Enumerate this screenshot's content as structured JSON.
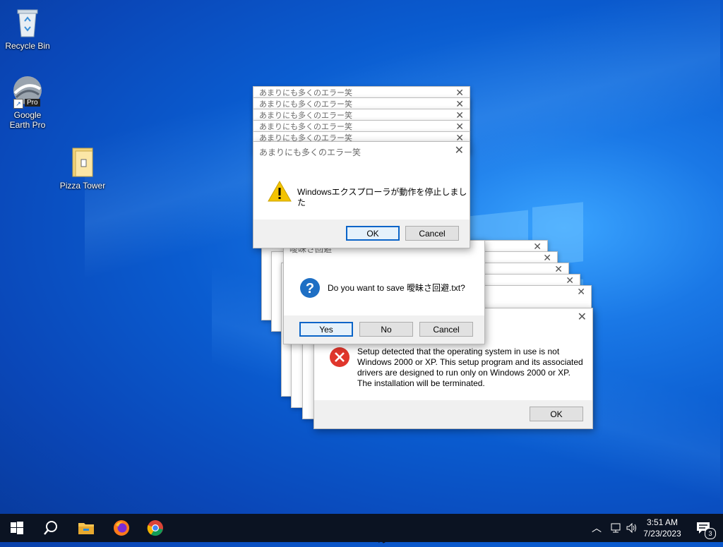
{
  "desktop": {
    "icons": [
      {
        "label": "Recycle Bin"
      },
      {
        "label": "Google Earth Pro",
        "badge": "Pro"
      },
      {
        "label": "Pizza Tower"
      }
    ]
  },
  "dialogs": {
    "japanese_stack": {
      "title": "あまりにも多くのエラー笑",
      "stub_title": "あまりにも多くのエラー笑",
      "message": "Windowsエクスプローラが動作を停止しました",
      "ok_label": "OK",
      "cancel_label": "Cancel",
      "icon": "warning-icon"
    },
    "save": {
      "title": "曖昧さ回避",
      "message": "Do you want to save 曖昧さ回避.txt?",
      "yes_label": "Yes",
      "no_label": "No",
      "cancel_label": "Cancel",
      "icon": "question-icon"
    },
    "setup": {
      "message_lines": [
        "Setup detected that the operating system in use is not",
        "Windows 2000 or XP. This setup program and its associated",
        "drivers are designed to run only on Windows 2000 or XP.",
        "The installation will be terminated."
      ],
      "ok_label": "OK",
      "icon": "error-icon"
    }
  },
  "taskbar": {
    "pinned": [
      "start-icon",
      "search-icon",
      "file-explorer-icon",
      "firefox-icon",
      "chrome-icon"
    ],
    "tray": {
      "time": "3:51 AM",
      "date": "7/23/2023",
      "notification_count": "3"
    }
  },
  "colors": {
    "accent": "#0a64c8",
    "taskbar": "#0b1322",
    "warning": "#f3c300",
    "question": "#1e6fc4",
    "error": "#e0362c"
  }
}
